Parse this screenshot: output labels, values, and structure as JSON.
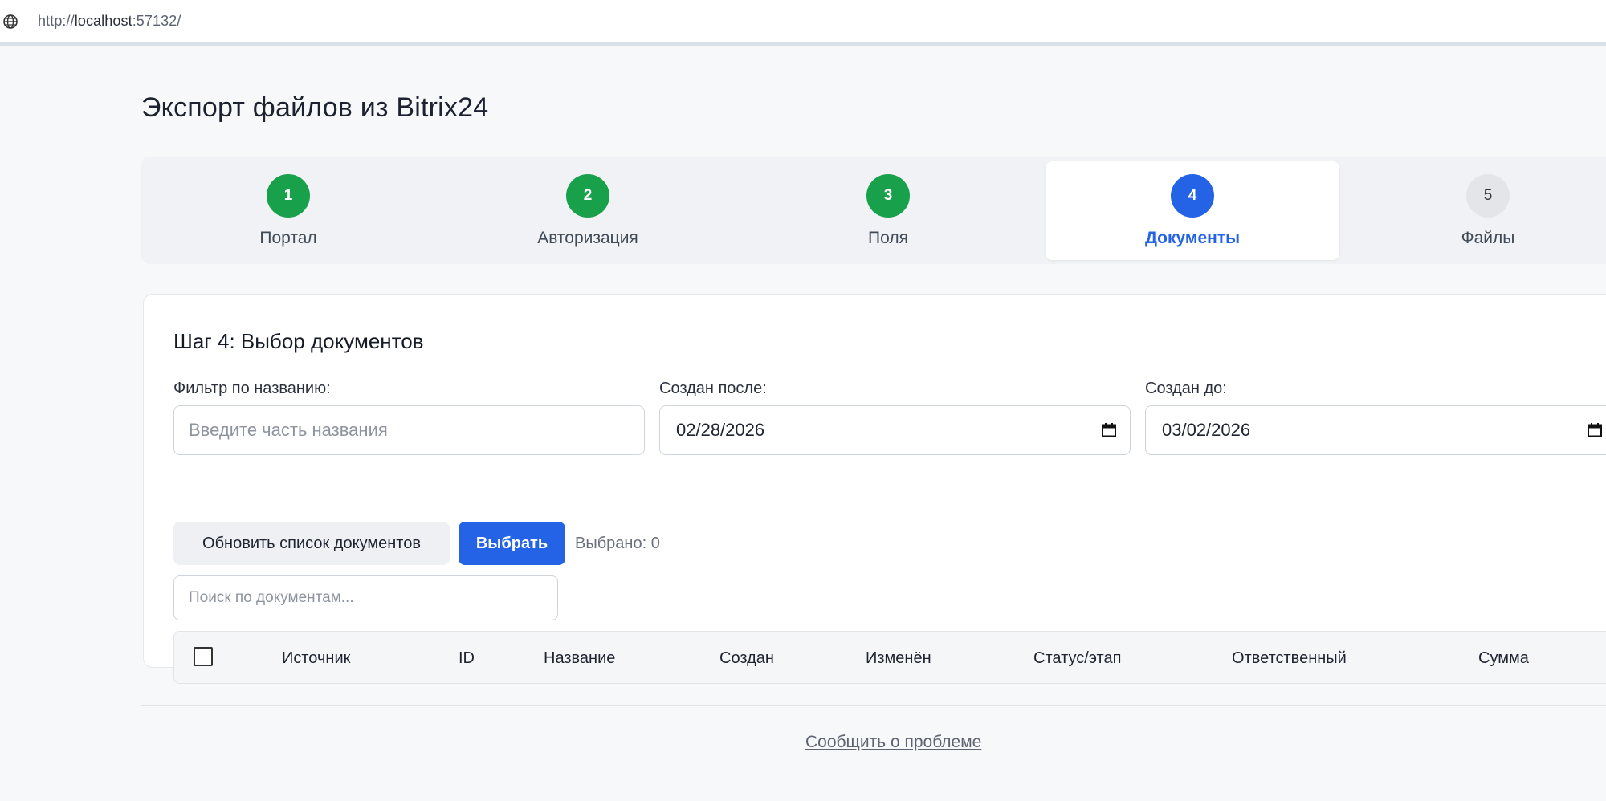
{
  "browser": {
    "url_prefix": "http://",
    "url_host": "localhost",
    "url_suffix": ":57132/"
  },
  "page_title": "Экспорт файлов из Bitrix24",
  "steps": [
    {
      "num": "1",
      "label": "Портал",
      "state": "done"
    },
    {
      "num": "2",
      "label": "Авторизация",
      "state": "done"
    },
    {
      "num": "3",
      "label": "Поля",
      "state": "done"
    },
    {
      "num": "4",
      "label": "Документы",
      "state": "current"
    },
    {
      "num": "5",
      "label": "Файлы",
      "state": "todo"
    }
  ],
  "card": {
    "heading": "Шаг 4: Выбор документов",
    "filter_name_label": "Фильтр по названию:",
    "filter_name_placeholder": "Введите часть названия",
    "created_after_label": "Создан после:",
    "created_after_value": "02/28/2026",
    "created_before_label": "Создан до:",
    "created_before_value": "03/02/2026",
    "refresh_button": "Обновить список документов",
    "select_button": "Выбрать",
    "selected_count": "Выбрано: 0",
    "search_placeholder": "Поиск по документам..."
  },
  "table": {
    "columns": [
      "Источник",
      "ID",
      "Название",
      "Создан",
      "Изменён",
      "Статус/этап",
      "Ответственный",
      "Сумма"
    ]
  },
  "footer": {
    "report_link": "Сообщить о проблеме"
  },
  "colors": {
    "done": "#18a14a",
    "current": "#2462e6",
    "todo": "#e3e5e8"
  }
}
